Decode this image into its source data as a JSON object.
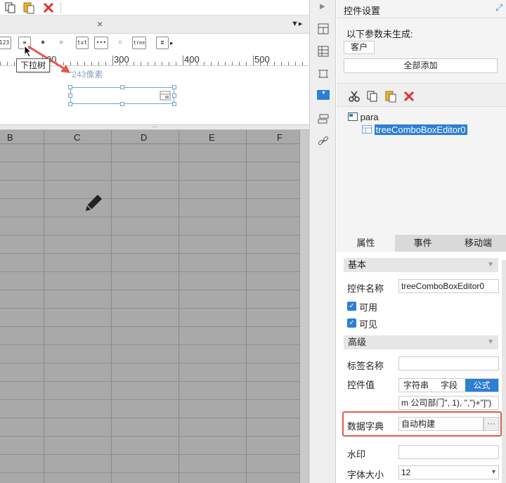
{
  "canvas": {
    "tab_close": "×",
    "ruler_labels": [
      "300",
      "400",
      "500"
    ],
    "ruler_partial": "00",
    "tooltip": "下拉树",
    "widget_width_label": "'243像素",
    "splitter_dots": "···",
    "columns": [
      "B",
      "C",
      "D",
      "E",
      "F"
    ],
    "widget_icons": [
      "123",
      "≡",
      "◉",
      "☑",
      "txt",
      "•••",
      "☐",
      "tree",
      "≣"
    ]
  },
  "panel": {
    "title": "控件设置",
    "not_generated_label": "以下参数未生成:",
    "param_chip": "客户",
    "add_all_button": "全部添加",
    "tree_root": "para",
    "tree_child": "treeComboBoxEditor0",
    "tabs": [
      "属性",
      "事件",
      "移动端"
    ],
    "active_tab": 0
  },
  "props": {
    "section_basic": "基本",
    "widget_name_label": "控件名称",
    "widget_name_value": "treeComboBoxEditor0",
    "enabled_label": "可用",
    "visible_label": "可见",
    "section_advanced": "高级",
    "tag_name_label": "标签名称",
    "tag_name_value": "",
    "widget_value_label": "控件值",
    "value_types": [
      "字符串",
      "字段",
      "公式"
    ],
    "value_type_selected": "公式",
    "formula_value": "m 公司部门\", 1), \",\")+\"]\")",
    "dict_label": "数据字典",
    "dict_value": "自动构建",
    "dict_button": "···",
    "watermark_label": "水印",
    "watermark_value": "",
    "font_size_label": "字体大小",
    "font_size_value": "12"
  },
  "colors": {
    "accent": "#2d7fd4",
    "highlight": "#e8584b",
    "grid": "#a9a9a9"
  }
}
